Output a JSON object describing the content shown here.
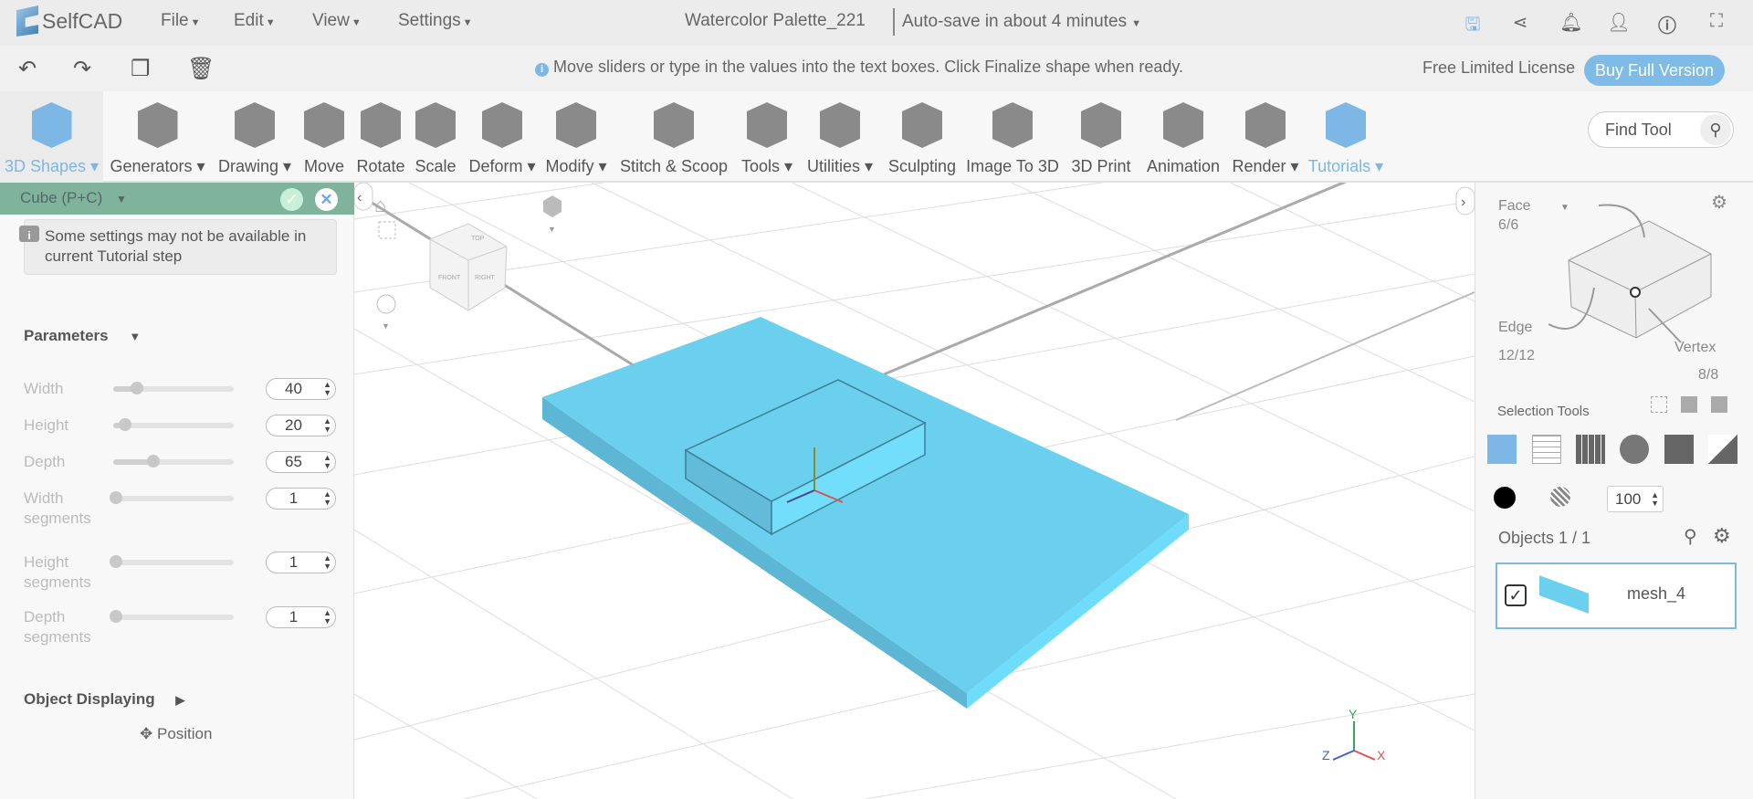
{
  "app": {
    "name": "SelfCAD",
    "menus": [
      "File",
      "Edit",
      "View",
      "Settings"
    ],
    "doc_title": "Watercolor Palette_221",
    "autosave": "Auto-save in about 4 minutes",
    "top_icons": [
      "save-icon",
      "share-icon",
      "bell-icon",
      "user-icon",
      "info-icon",
      "fullscreen-icon"
    ]
  },
  "bar2": {
    "hint": "Move sliders or type in the values into the text boxes. Click Finalize shape when ready.",
    "license": "Free Limited License",
    "buy": "Buy Full Version",
    "icons": [
      "undo-icon",
      "redo-icon",
      "copy-icon",
      "delete-icon"
    ]
  },
  "ribbon": {
    "tools": [
      {
        "label": "3D Shapes ▾"
      },
      {
        "label": "Generators ▾"
      },
      {
        "label": "Drawing ▾"
      },
      {
        "label": "Move"
      },
      {
        "label": "Rotate"
      },
      {
        "label": "Scale"
      },
      {
        "label": "Deform ▾"
      },
      {
        "label": "Modify ▾"
      },
      {
        "label": "Stitch & Scoop"
      },
      {
        "label": "Tools ▾"
      },
      {
        "label": "Utilities ▾"
      },
      {
        "label": "Sculpting"
      },
      {
        "label": "Image To 3D"
      },
      {
        "label": "3D Print"
      },
      {
        "label": "Animation"
      },
      {
        "label": "Render ▾"
      },
      {
        "label": "Tutorials ▾"
      }
    ],
    "find_placeholder": "Find Tool"
  },
  "left": {
    "title": "Cube (P+C)",
    "notice": "Some settings may not be available in current Tutorial step",
    "parameters": "Parameters",
    "params": [
      {
        "name": "Width",
        "value": "40",
        "fraction": 0.2
      },
      {
        "name": "Height",
        "value": "20",
        "fraction": 0.1
      },
      {
        "name": "Depth",
        "value": "65",
        "fraction": 0.33
      },
      {
        "name": "Width segments",
        "value": "1",
        "fraction": 0
      },
      {
        "name": "Height segments",
        "value": "1",
        "fraction": 0
      },
      {
        "name": "Depth segments",
        "value": "1",
        "fraction": 0
      }
    ],
    "object_displaying": "Object Displaying",
    "position": "Position"
  },
  "right": {
    "face": "Face",
    "face_count": "6/6",
    "edge": "Edge",
    "edge_count": "12/12",
    "vertex": "Vertex",
    "vertex_count": "8/8",
    "selection_tools": "Selection Tools",
    "opacity": "100",
    "objects": "Objects 1 / 1",
    "object_name": "mesh_4"
  },
  "viewport": {
    "axes": {
      "x": "X",
      "y": "Y",
      "z": "Z"
    },
    "cube_faces": {
      "top": "TOP",
      "front": "FRONT",
      "right": "RIGHT"
    }
  },
  "colors": {
    "accent": "#7db7e6",
    "header_green": "#7fb39b",
    "object": "#6bd0ee"
  }
}
